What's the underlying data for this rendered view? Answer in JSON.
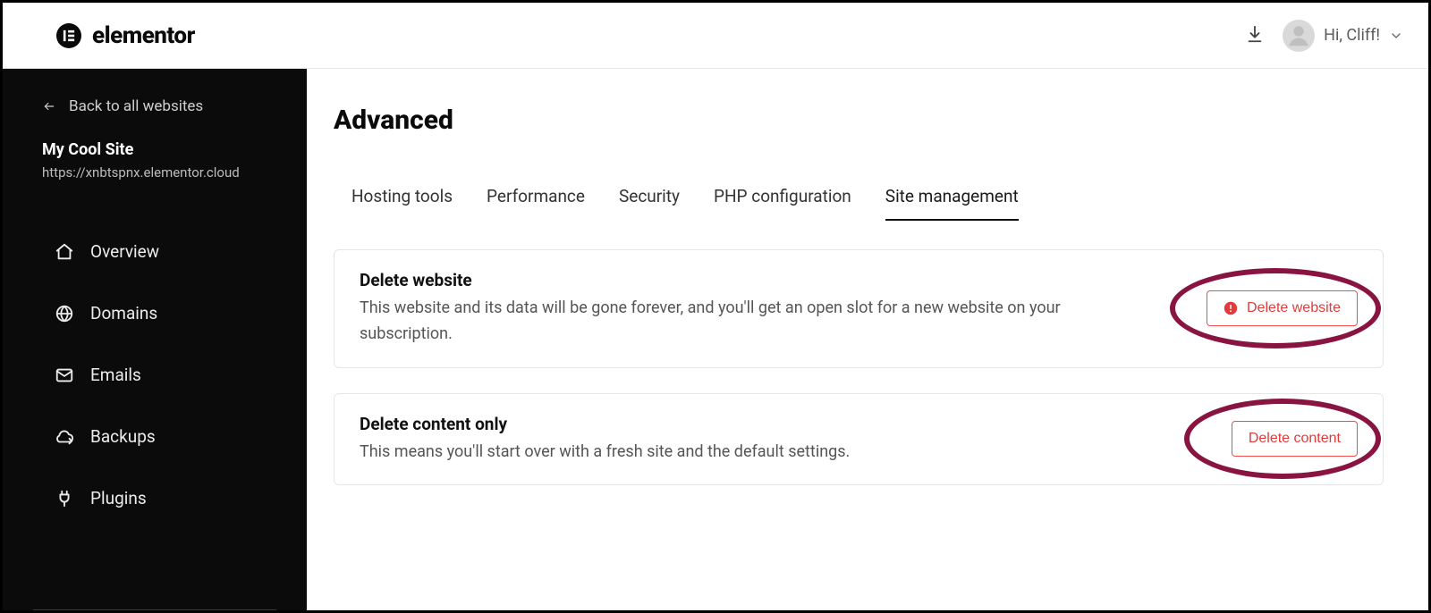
{
  "brand": {
    "word": "elementor"
  },
  "header": {
    "greeting": "Hi, Cliff!"
  },
  "sidebar": {
    "back_label": "Back to all websites",
    "site_name": "My Cool Site",
    "site_url": "https://xnbtspnx.elementor.cloud",
    "items": [
      {
        "label": "Overview"
      },
      {
        "label": "Domains"
      },
      {
        "label": "Emails"
      },
      {
        "label": "Backups"
      },
      {
        "label": "Plugins"
      }
    ]
  },
  "main": {
    "title": "Advanced",
    "tabs": [
      {
        "label": "Hosting tools",
        "active": false
      },
      {
        "label": "Performance",
        "active": false
      },
      {
        "label": "Security",
        "active": false
      },
      {
        "label": "PHP configuration",
        "active": false
      },
      {
        "label": "Site management",
        "active": true
      }
    ],
    "cards": [
      {
        "title": "Delete website",
        "desc": "This website and its data will be gone forever, and you'll get an open slot for a new website on your subscription.",
        "button": "Delete website",
        "hasWarnIcon": true
      },
      {
        "title": "Delete content only",
        "desc": "This means you'll start over with a fresh site and the default settings.",
        "button": "Delete content",
        "hasWarnIcon": false
      }
    ]
  }
}
